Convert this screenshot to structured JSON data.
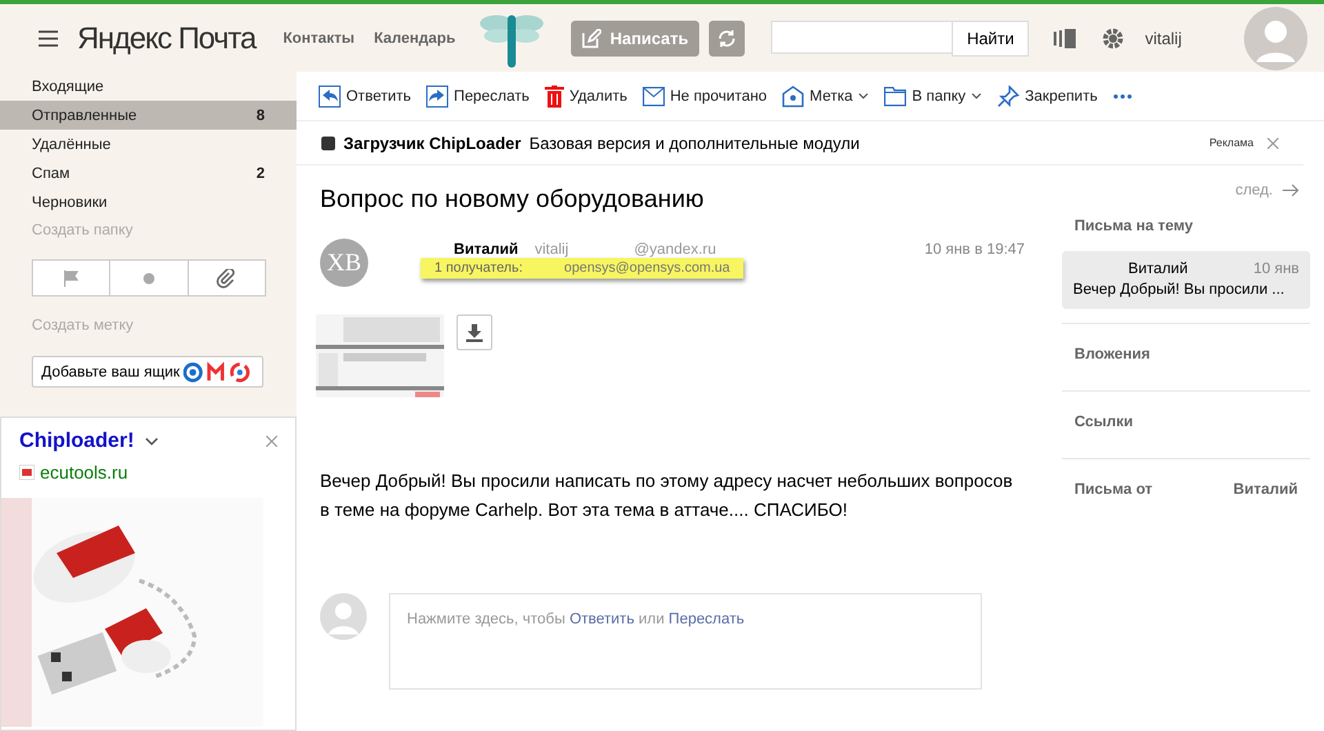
{
  "header": {
    "logo": "Яндекс Почта",
    "nav": [
      {
        "label": "Контакты"
      },
      {
        "label": "Календарь"
      }
    ],
    "compose": "Написать",
    "search": {
      "button": "Найти"
    },
    "user": "vitalij"
  },
  "sidebar": {
    "folders": [
      {
        "label": "Входящие",
        "selected": false
      },
      {
        "label": "Отправленные",
        "count": "8",
        "selected": true
      },
      {
        "label": "Удалённые",
        "selected": false
      },
      {
        "label": "Спам",
        "count": "2",
        "selected": false
      },
      {
        "label": "Черновики",
        "selected": false
      }
    ],
    "create_folder": "Создать папку",
    "filters": [
      {
        "kind": "flag"
      },
      {
        "kind": "dot"
      },
      {
        "kind": "clip"
      }
    ],
    "create_label": "Создать метку",
    "add_mailbox": "Добавьте ваш ящик"
  },
  "ad_box": {
    "title": "Chiploader!",
    "domain": "ecutools.ru"
  },
  "toolbar": [
    {
      "kind": "reply",
      "label": "Ответить",
      "menu": false
    },
    {
      "kind": "forward",
      "label": "Переслать",
      "menu": false
    },
    {
      "kind": "delete",
      "label": "Удалить",
      "menu": false
    },
    {
      "kind": "unread",
      "label": "Не прочитано",
      "menu": false
    },
    {
      "kind": "label",
      "label": "Метка",
      "menu": true
    },
    {
      "kind": "folder",
      "label": "В папку",
      "menu": true
    },
    {
      "kind": "pin",
      "label": "Закрепить",
      "menu": false
    },
    {
      "kind": "more",
      "menu": false
    }
  ],
  "ad_banner": {
    "title": "Загрузчик ChipLoader",
    "text": "Базовая версия и дополнительные модули",
    "tag": "Реклама"
  },
  "message": {
    "subject": "Вопрос по новому оборудованию",
    "avatar": "ХВ",
    "sender": "Виталий",
    "login": "vitalij",
    "domain": "@yandex.ru",
    "date": "10 янв в 19:47",
    "recipients_label": "1 получатель:",
    "recipient": "opensys@opensys.com.ua",
    "body": "Вечер Добрый! Вы просили написать по этому адресу насчет небольших вопросов в теме на форуме Carhelp. Вот эта тема в аттаче.... СПАСИБО!",
    "reply_hint": {
      "prefix": "Нажмите здесь, чтобы",
      "reply": "Ответить",
      "middle": "или",
      "forward": "Переслать"
    }
  },
  "right_panel": {
    "next": "след.",
    "thread_title": "Письма на тему",
    "thread": [
      {
        "sender": "Виталий",
        "date": "10 янв",
        "snippet": "Вечер Добрый! Вы просили ...",
        "selected": true
      }
    ],
    "sections": [
      {
        "label": "Вложения"
      },
      {
        "label": "Ссылки"
      },
      {
        "label": "Письма от",
        "value": "Виталий"
      }
    ]
  }
}
